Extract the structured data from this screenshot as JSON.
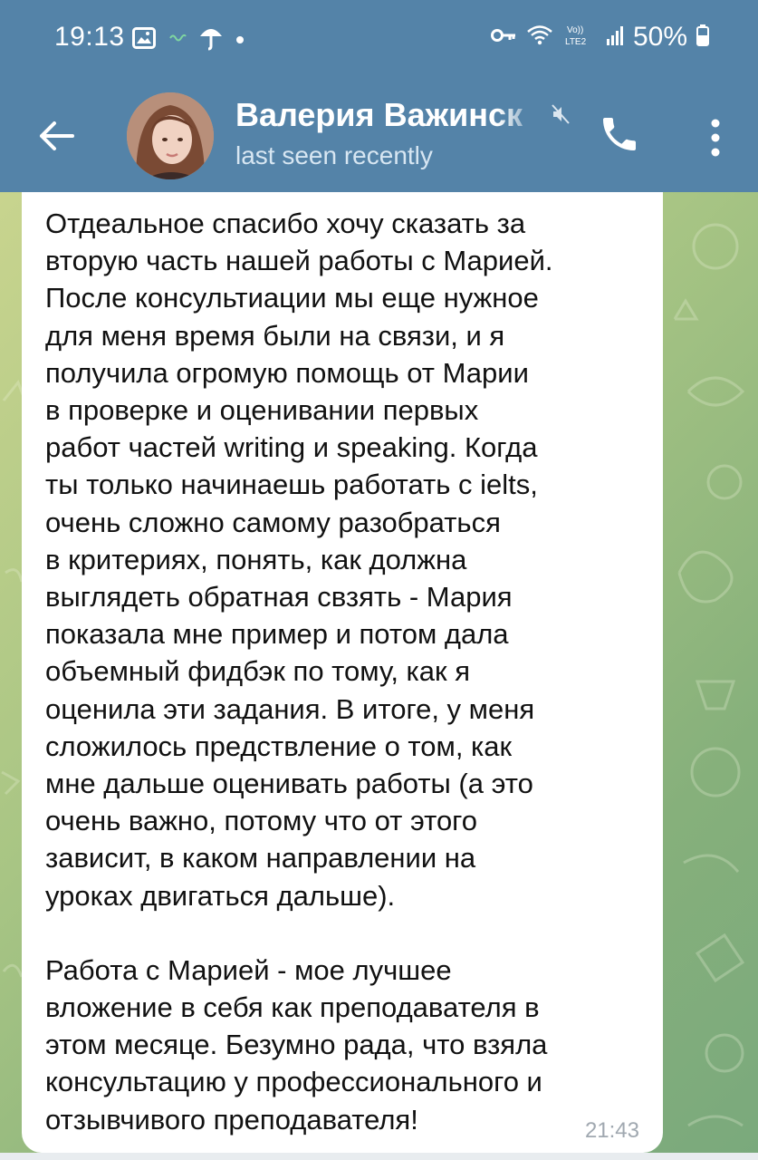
{
  "status_bar": {
    "time": "19:13",
    "battery": "50%",
    "left_icons": [
      "gallery-icon",
      "link-icon",
      "umbrella-icon",
      "dot-icon"
    ],
    "right_icons": [
      "key-icon",
      "wifi-icon",
      "volte-icon",
      "signal-icon",
      "battery-icon"
    ],
    "network_label": "Vo)) LTE2"
  },
  "header": {
    "title": "Валерия Важинск",
    "subtitle": "last seen recently",
    "icons": [
      "back-arrow-icon",
      "mute-icon",
      "phone-icon",
      "more-vert-icon"
    ]
  },
  "message": {
    "paragraph1": "Отдеальное спасибо хочу сказать за\nвторую часть нашей работы с Марией.\nПосле консультиации мы еще нужное\nдля меня время были на связи, и я\nполучила огромую помощь от Марии\nв проверке и оценивании первых\nработ частей writing и speaking. Когда\nты только начинаешь работать с ielts,\nочень сложно самому разобраться\nв критериях, понять, как должна\nвыглядеть обратная свзять - Мария\nпоказала мне пример и потом дала\nобъемный фидбэк по тому, как я\nоценила эти задания. В итоге, у меня\nсложилось предствление о том, как\nмне дальше оценивать работы (а это\nочень важно, потому что от этого\nзависит, в каком направлении на\nуроках двигаться дальше).",
    "paragraph2": "Работа с Марией - мое лучшее\nвложение в себя как преподавателя в\nэтом месяце. Безумно рада, что взяла\nконсультацию у профессионального и\nотзывчивого преподавателя!",
    "time": "21:43"
  },
  "colors": {
    "header_bg": "#5483a8",
    "bubble_bg": "#ffffff",
    "chat_bg_start": "#c8d48e",
    "chat_bg_end": "#7aa97c",
    "time_color": "#a0a8b0"
  }
}
